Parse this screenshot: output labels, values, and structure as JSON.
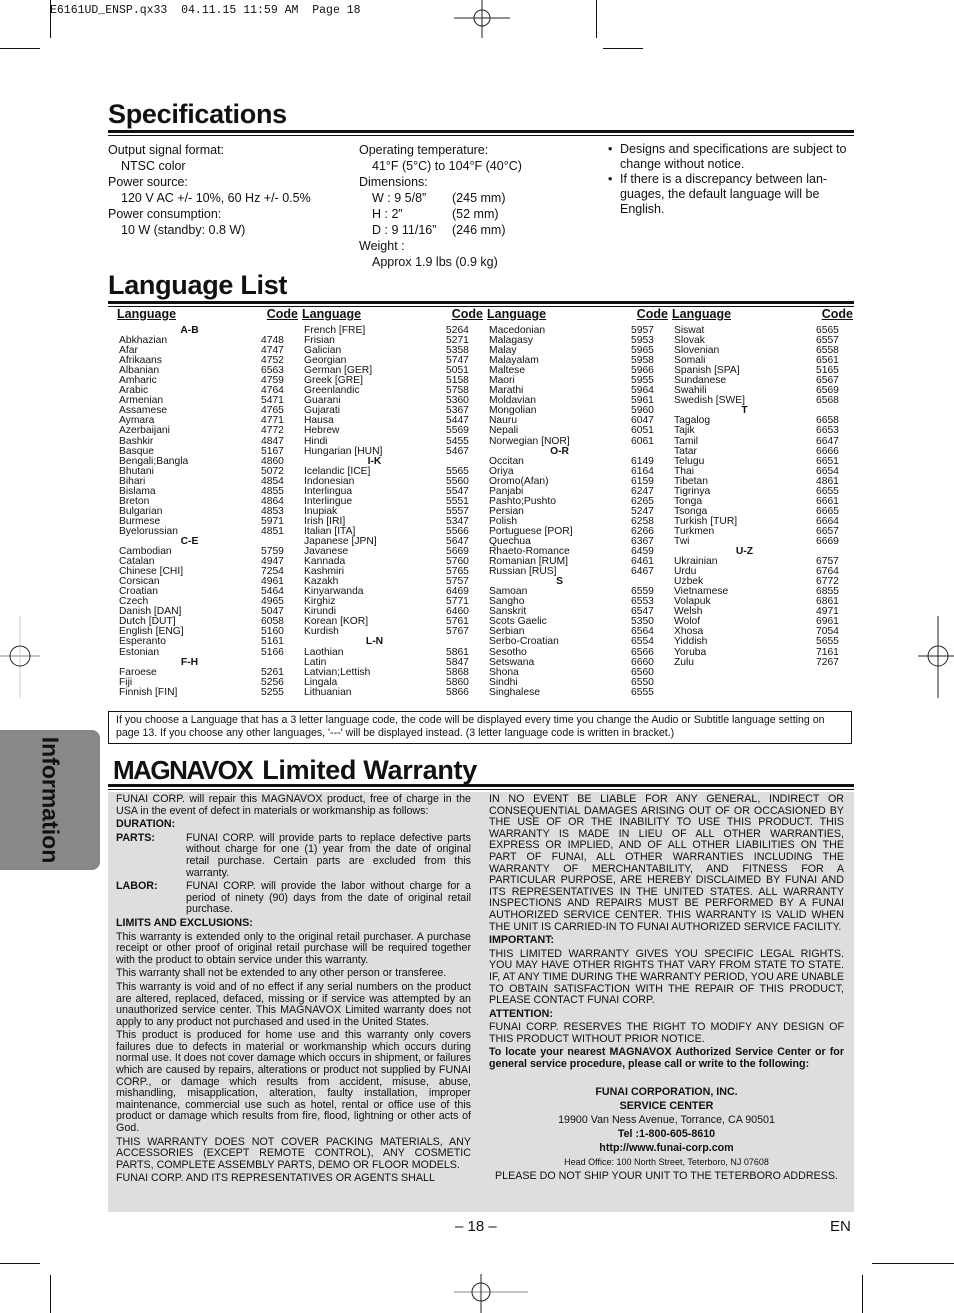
{
  "slug": "E6161UD_ENSP.qx33  04.11.15 11:59 AM  Page 18",
  "side_tab": "Information",
  "specifications": {
    "title": "Specifications",
    "col1": [
      {
        "label": "Output signal format:",
        "value": "NTSC color"
      },
      {
        "label": "Power source:",
        "value": "120 V AC +/- 10%, 60 Hz +/- 0.5%"
      },
      {
        "label": "Power consumption:",
        "value": "10 W (standby: 0.8 W)"
      }
    ],
    "col2": {
      "temp_label": "Operating temperature:",
      "temp_value": "41°F (5°C) to 104°F (40°C)",
      "dim_label": "Dimensions:",
      "dims": [
        {
          "k": "W : 9 5/8”",
          "v": "(245 mm)"
        },
        {
          "k": "H : 2”",
          "v": "(52 mm)"
        },
        {
          "k": "D : 9 11/16”",
          "v": "(246 mm)"
        }
      ],
      "weight_label": "Weight :",
      "weight_value": "Approx 1.9 lbs (0.9 kg)"
    },
    "notes": [
      "Designs and specifications are subject to change without notice.",
      "If there is a discrepancy between lan-guages, the default language will be English."
    ]
  },
  "language_list": {
    "title": "Language List",
    "header_language": "Language",
    "header_code": "Code",
    "columns": [
      [
        {
          "section": "A-B"
        },
        [
          "Abkhazian",
          "4748"
        ],
        [
          "Afar",
          "4747"
        ],
        [
          "Afrikaans",
          "4752"
        ],
        [
          "Albanian",
          "6563"
        ],
        [
          "Amharic",
          "4759"
        ],
        [
          "Arabic",
          "4764"
        ],
        [
          "Armenian",
          "5471"
        ],
        [
          "Assamese",
          "4765"
        ],
        [
          "Aymara",
          "4771"
        ],
        [
          "Azerbaijani",
          "4772"
        ],
        [
          "Bashkir",
          "4847"
        ],
        [
          "Basque",
          "5167"
        ],
        [
          "Bengali;Bangla",
          "4860"
        ],
        [
          "Bhutani",
          "5072"
        ],
        [
          "Bihari",
          "4854"
        ],
        [
          "Bislama",
          "4855"
        ],
        [
          "Breton",
          "4864"
        ],
        [
          "Bulgarian",
          "4853"
        ],
        [
          "Burmese",
          "5971"
        ],
        [
          "Byelorussian",
          "4851"
        ],
        {
          "section": "C-E"
        },
        [
          "Cambodian",
          "5759"
        ],
        [
          "Catalan",
          "4947"
        ],
        [
          "Chinese [CHI]",
          "7254"
        ],
        [
          "Corsican",
          "4961"
        ],
        [
          "Croatian",
          "5464"
        ],
        [
          "Czech",
          "4965"
        ],
        [
          "Danish [DAN]",
          "5047"
        ],
        [
          "Dutch [DUT]",
          "6058"
        ],
        [
          "English [ENG]",
          "5160"
        ],
        [
          "Esperanto",
          "5161"
        ],
        [
          "Estonian",
          "5166"
        ],
        {
          "section": "F-H"
        },
        [
          "Faroese",
          "5261"
        ],
        [
          "Fiji",
          "5256"
        ],
        [
          "Finnish [FIN]",
          "5255"
        ]
      ],
      [
        [
          "French [FRE]",
          "5264"
        ],
        [
          "Frisian",
          "5271"
        ],
        [
          "Galician",
          "5358"
        ],
        [
          "Georgian",
          "5747"
        ],
        [
          "German [GER]",
          "5051"
        ],
        [
          "Greek [GRE]",
          "5158"
        ],
        [
          "Greenlandic",
          "5758"
        ],
        [
          "Guarani",
          "5360"
        ],
        [
          "Gujarati",
          "5367"
        ],
        [
          "Hausa",
          "5447"
        ],
        [
          "Hebrew",
          "5569"
        ],
        [
          "Hindi",
          "5455"
        ],
        [
          "Hungarian [HUN]",
          "5467"
        ],
        {
          "section": "I-K"
        },
        [
          "Icelandic [ICE]",
          "5565"
        ],
        [
          "Indonesian",
          "5560"
        ],
        [
          "Interlingua",
          "5547"
        ],
        [
          "Interlingue",
          "5551"
        ],
        [
          "Inupiak",
          "5557"
        ],
        [
          "Irish [IRI]",
          "5347"
        ],
        [
          "Italian [ITA]",
          "5566"
        ],
        [
          "Japanese [JPN]",
          "5647"
        ],
        [
          "Javanese",
          "5669"
        ],
        [
          "Kannada",
          "5760"
        ],
        [
          "Kashmiri",
          "5765"
        ],
        [
          "Kazakh",
          "5757"
        ],
        [
          "Kinyarwanda",
          "6469"
        ],
        [
          "Kirghiz",
          "5771"
        ],
        [
          "Kirundi",
          "6460"
        ],
        [
          "Korean [KOR]",
          "5761"
        ],
        [
          "Kurdish",
          "5767"
        ],
        {
          "section": "L-N"
        },
        [
          "Laothian",
          "5861"
        ],
        [
          "Latin",
          "5847"
        ],
        [
          "Latvian;Lettish",
          "5868"
        ],
        [
          "Lingala",
          "5860"
        ],
        [
          "Lithuanian",
          "5866"
        ]
      ],
      [
        [
          "Macedonian",
          "5957"
        ],
        [
          "Malagasy",
          "5953"
        ],
        [
          "Malay",
          "5965"
        ],
        [
          "Malayalam",
          "5958"
        ],
        [
          "Maltese",
          "5966"
        ],
        [
          "Maori",
          "5955"
        ],
        [
          "Marathi",
          "5964"
        ],
        [
          "Moldavian",
          "5961"
        ],
        [
          "Mongolian",
          "5960"
        ],
        [
          "Nauru",
          "6047"
        ],
        [
          "Nepali",
          "6051"
        ],
        [
          "Norwegian [NOR]",
          "6061"
        ],
        {
          "section": "O-R"
        },
        [
          "Occitan",
          "6149"
        ],
        [
          "Oriya",
          "6164"
        ],
        [
          "Oromo(Afan)",
          "6159"
        ],
        [
          "Panjabi",
          "6247"
        ],
        [
          "Pashto;Pushto",
          "6265"
        ],
        [
          "Persian",
          "5247"
        ],
        [
          "Polish",
          "6258"
        ],
        [
          "Portuguese [POR]",
          "6266"
        ],
        [
          "Quechua",
          "6367"
        ],
        [
          "Rhaeto-Romance",
          "6459"
        ],
        [
          "Romanian [RUM]",
          "6461"
        ],
        [
          "Russian [RUS]",
          "6467"
        ],
        {
          "section": "S"
        },
        [
          "Samoan",
          "6559"
        ],
        [
          "Sangho",
          "6553"
        ],
        [
          "Sanskrit",
          "6547"
        ],
        [
          "Scots Gaelic",
          "5350"
        ],
        [
          "Serbian",
          "6564"
        ],
        [
          "Serbo-Croatian",
          "6554"
        ],
        [
          "Sesotho",
          "6566"
        ],
        [
          "Setswana",
          "6660"
        ],
        [
          "Shona",
          "6560"
        ],
        [
          "Sindhi",
          "6550"
        ],
        [
          "Singhalese",
          "6555"
        ]
      ],
      [
        [
          "Siswat",
          "6565"
        ],
        [
          "Slovak",
          "6557"
        ],
        [
          "Slovenian",
          "6558"
        ],
        [
          "Somali",
          "6561"
        ],
        [
          "Spanish [SPA]",
          "5165"
        ],
        [
          "Sundanese",
          "6567"
        ],
        [
          "Swahili",
          "6569"
        ],
        [
          "Swedish [SWE]",
          "6568"
        ],
        {
          "section": "T"
        },
        [
          "Tagalog",
          "6658"
        ],
        [
          "Tajik",
          "6653"
        ],
        [
          "Tamil",
          "6647"
        ],
        [
          "Tatar",
          "6666"
        ],
        [
          "Telugu",
          "6651"
        ],
        [
          "Thai",
          "6654"
        ],
        [
          "Tibetan",
          "4861"
        ],
        [
          "Tigrinya",
          "6655"
        ],
        [
          "Tonga",
          "6661"
        ],
        [
          "Tsonga",
          "6665"
        ],
        [
          "Turkish [TUR]",
          "6664"
        ],
        [
          "Turkmen",
          "6657"
        ],
        [
          "Twi",
          "6669"
        ],
        {
          "section": "U-Z"
        },
        [
          "Ukrainian",
          "6757"
        ],
        [
          "Urdu",
          "6764"
        ],
        [
          "Uzbek",
          "6772"
        ],
        [
          "Vietnamese",
          "6855"
        ],
        [
          "Volapuk",
          "6861"
        ],
        [
          "Welsh",
          "4971"
        ],
        [
          "Wolof",
          "6961"
        ],
        [
          "Xhosa",
          "7054"
        ],
        [
          "Yiddish",
          "5655"
        ],
        [
          "Yoruba",
          "7161"
        ],
        [
          "Zulu",
          "7267"
        ]
      ]
    ],
    "note": "If you choose a Language that has a 3 letter language code, the code will be displayed every time you change the Audio or Subtitle language setting on page 13. If you choose any other languages, '---' will be displayed instead. (3 letter language code is written in bracket.)"
  },
  "warranty": {
    "brand": "MAGNAVOX",
    "title": "Limited Warranty",
    "left": {
      "intro": "FUNAI CORP. will repair this MAGNAVOX product, free of charge in the USA in the event of defect in materials or workmanship as follows:",
      "duration_label": "DURATION:",
      "parts_label": "PARTS:",
      "parts_text": "FUNAI CORP. will provide parts to replace defective parts without charge for one (1) year from the date of original retail purchase. Certain parts are excluded from this warranty.",
      "labor_label": "LABOR:",
      "labor_text": "FUNAI CORP. will provide the labor without charge for a period of ninety (90) days from the date of original retail purchase.",
      "limits_label": "LIMITS AND EXCLUSIONS:",
      "p1": "This warranty is extended only to the original retail purchaser. A purchase receipt or other proof of original retail purchase will be required together with the product to obtain service under this warranty.",
      "p2": "This warranty shall not be extended to any other person or transferee.",
      "p3": "This warranty is void and of no effect if any serial numbers on the product are altered, replaced, defaced, missing or if service was attempted by an unauthorized service center. This MAGNAVOX Limited warranty does not apply to any product not purchased and used in the United States.",
      "p4": "This product is produced for home use and this warranty only covers failures due to defects in material or workmanship which occurs during normal use. It does not cover damage which occurs in shipment, or failures which are caused by repairs, alterations or product not supplied by FUNAI CORP., or damage which results from accident, misuse, abuse, mishandling, misapplication, alteration, faulty installation, improper maintenance, commercial use such as hotel, rental or office use of this product or damage which results from fire, flood, lightning or other acts of God.",
      "p5": "THIS WARRANTY DOES NOT COVER PACKING MATERIALS, ANY ACCESSORIES (EXCEPT REMOTE CONTROL), ANY COSMETIC PARTS, COMPLETE ASSEMBLY PARTS, DEMO OR FLOOR MODELS.",
      "p6": "FUNAI CORP. AND ITS REPRESENTATIVES OR AGENTS SHALL"
    },
    "right": {
      "p1": "IN NO EVENT BE LIABLE FOR ANY GENERAL, INDIRECT OR CONSEQUENTIAL DAMAGES ARISING OUT OF OR OCCASIONED BY THE USE OF OR THE INABILITY TO USE THIS PRODUCT. THIS WARRANTY IS MADE IN LIEU OF ALL OTHER WARRANTIES, EXPRESS OR IMPLIED, AND OF ALL OTHER LIABILITIES ON THE PART OF FUNAI, ALL OTHER WARRANTIES INCLUDING THE WARRANTY OF MERCHANTABILITY, AND FITNESS FOR A PARTICULAR PURPOSE, ARE HEREBY DISCLAIMED BY FUNAI AND ITS REPRESENTATIVES IN THE UNITED STATES. ALL WARRANTY INSPECTIONS AND REPAIRS MUST BE PERFORMED BY A FUNAI AUTHORIZED SERVICE CENTER. THIS WARRANTY IS VALID WHEN THE UNIT IS CARRIED-IN TO FUNAI AUTHORIZED SERVICE FACILITY.",
      "important_label": "IMPORTANT:",
      "important_text": "THIS LIMITED WARRANTY GIVES YOU SPECIFIC LEGAL RIGHTS. YOU MAY HAVE OTHER RIGHTS THAT VARY FROM STATE TO STATE. IF, AT ANY TIME DURING THE WARRANTY PERIOD, YOU ARE UNABLE TO OBTAIN SATISFACTION WITH THE REPAIR OF THIS PRODUCT, PLEASE CONTACT FUNAI CORP.",
      "attention_label": "ATTENTION:",
      "attention_text": "FUNAI CORP. RESERVES THE RIGHT TO MODIFY ANY DESIGN OF THIS PRODUCT WITHOUT PRIOR NOTICE.",
      "locate": "To locate your nearest MAGNAVOX Authorized Service Center or for general service procedure, please call or write to the following:",
      "company": "FUNAI CORPORATION, INC.",
      "service_center": "SERVICE CENTER",
      "address": "19900 Van Ness Avenue, Torrance, CA 90501",
      "tel": "Tel :1-800-605-8610",
      "url": "http://www.funai-corp.com",
      "head_office": "Head Office: 100 North Street, Teterboro, NJ 07608",
      "no_ship": "PLEASE DO NOT SHIP YOUR UNIT TO THE TETERBORO ADDRESS."
    }
  },
  "footer": {
    "page": "– 18 –",
    "lang": "EN"
  }
}
